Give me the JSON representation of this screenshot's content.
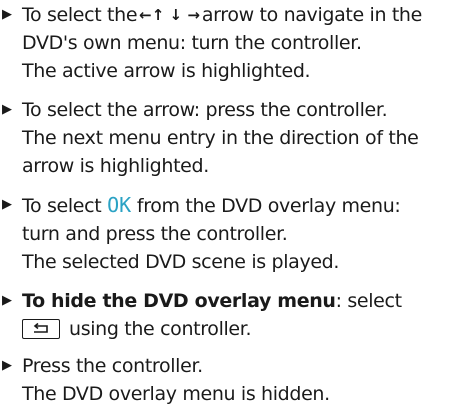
{
  "steps": [
    {
      "marker": "▶",
      "lines": {
        "l1_before": "To select the",
        "l1_arrows": "←↑ ↓ →",
        "l1_after": "arrow to navigate in the",
        "l2": "DVD's own menu: turn the controller.",
        "l3": "The active arrow is highlighted."
      }
    },
    {
      "marker": "▶",
      "lines": {
        "l1": "To select the arrow: press the controller.",
        "l2": "The next menu entry in the direction of the",
        "l3": "arrow is highlighted."
      }
    },
    {
      "marker": "▶",
      "lines": {
        "l1_before": "To select",
        "l1_ok": "OK",
        "l1_after": "from the DVD overlay menu:",
        "l2": "turn and press the controller.",
        "l3": "The selected DVD scene is played."
      }
    },
    {
      "marker": "▶",
      "lines": {
        "l1_bold": "To hide the DVD overlay menu",
        "l1_after": ": select",
        "l2_icon": "back-key-icon",
        "l2_after": "using the controller."
      }
    },
    {
      "marker": "▶",
      "lines": {
        "l1": "Press the controller.",
        "l2": "The DVD overlay menu is hidden."
      }
    }
  ],
  "colors": {
    "text": "#1a1a1a",
    "ok_accent": "#2aa2c4"
  }
}
